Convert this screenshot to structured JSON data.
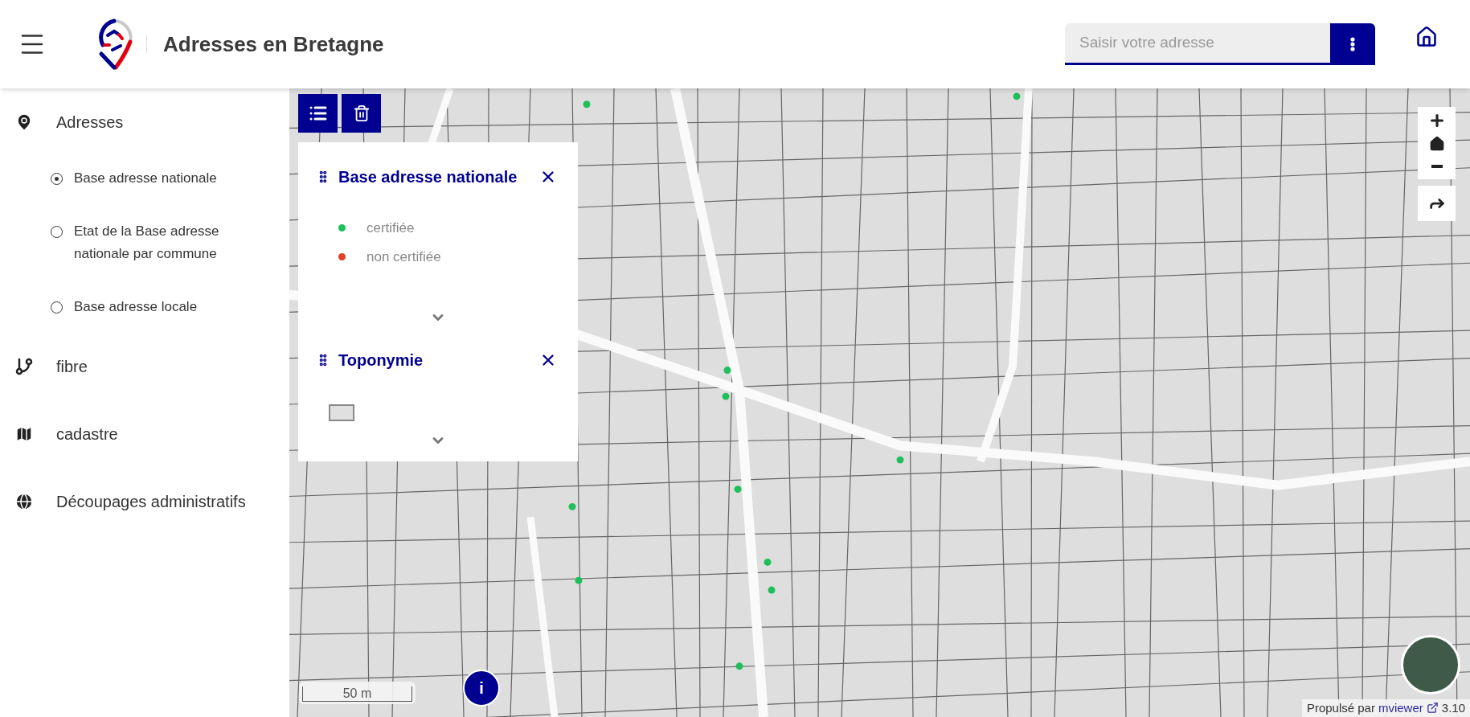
{
  "header": {
    "title": "Adresses en Bretagne",
    "search": {
      "placeholder": "Saisir votre adresse"
    }
  },
  "sidebar": {
    "themes": [
      {
        "label": "Adresses",
        "layers": [
          {
            "label": "Base adresse nationale",
            "selected": true
          },
          {
            "label": "Etat de la Base adresse nationale par commune",
            "selected": false
          },
          {
            "label": "Base adresse locale",
            "selected": false
          }
        ]
      },
      {
        "label": "fibre"
      },
      {
        "label": "cadastre"
      },
      {
        "label": "Découpages administratifs"
      }
    ]
  },
  "legend": [
    {
      "title": "Base adresse nationale",
      "kind": "points",
      "items": [
        {
          "label": "certifiée",
          "color": "#1fbf5b"
        },
        {
          "label": "non certifiée",
          "color": "#e0402a"
        }
      ]
    },
    {
      "title": "Toponymie",
      "kind": "polygon"
    }
  ],
  "map": {
    "info": "i",
    "scale": "50 m",
    "attribution": {
      "prefix": "Propulsé par",
      "link": "mviewer",
      "version": "3.10"
    }
  }
}
